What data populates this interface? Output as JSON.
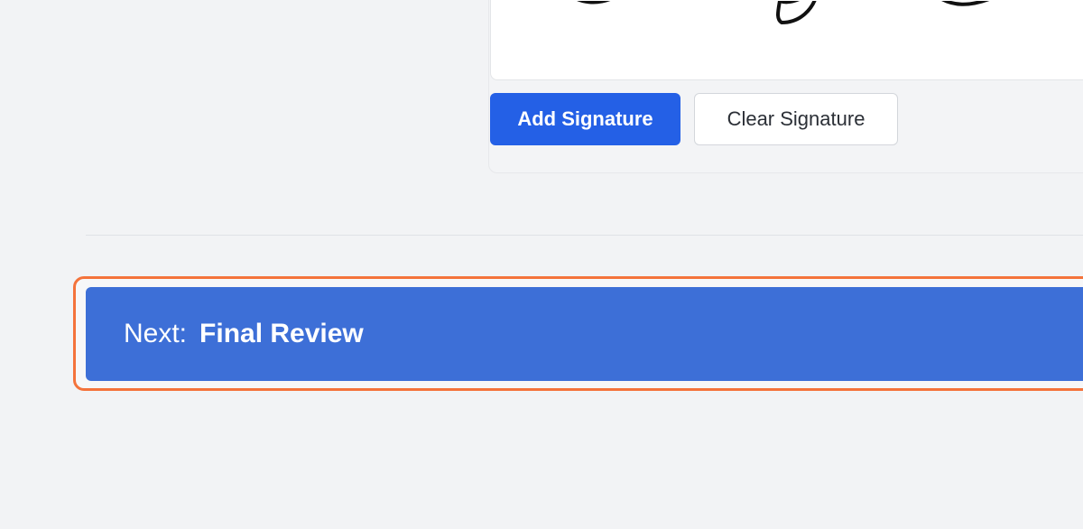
{
  "signature_section": {
    "add_label": "Add Signature",
    "clear_label": "Clear Signature"
  },
  "next_step": {
    "prefix": "Next:",
    "title": "Final Review"
  },
  "colors": {
    "primary": "#2460e6",
    "next_bar": "#3d6fd7",
    "focus_ring": "#f4733b",
    "background": "#f2f3f5"
  }
}
